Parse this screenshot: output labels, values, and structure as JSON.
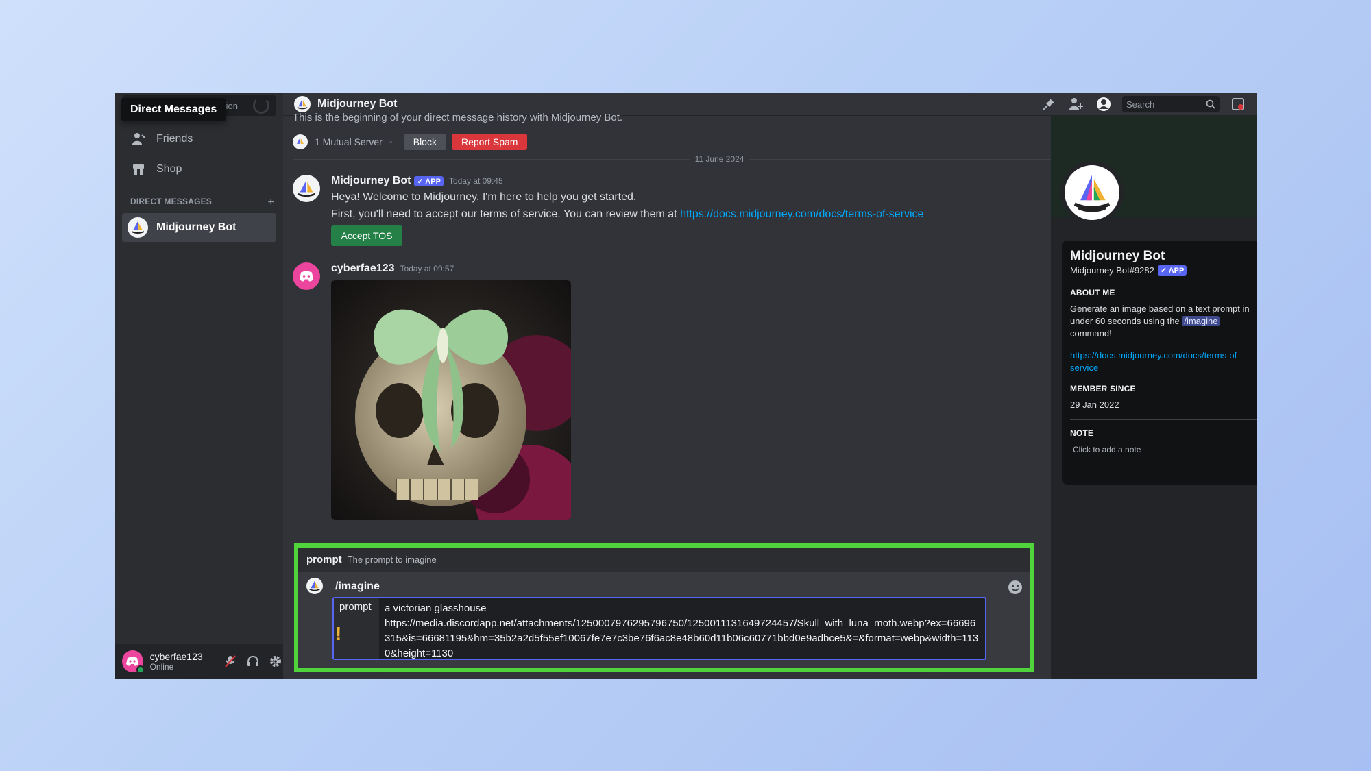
{
  "sidebar": {
    "tooltip": "Direct Messages",
    "search_fragment": "sation",
    "nav": [
      {
        "label": "Friends"
      },
      {
        "label": "Shop"
      }
    ],
    "dm_section_title": "DIRECT MESSAGES",
    "dm_add": "+",
    "dm_items": [
      {
        "label": "Midjourney Bot"
      }
    ]
  },
  "user": {
    "name": "cyberfae123",
    "status": "Online"
  },
  "topbar": {
    "title": "Midjourney Bot",
    "search_placeholder": "Search"
  },
  "chat": {
    "history_text": "This is the beginning of your direct message history with Midjourney Bot.",
    "mutual_server": "1 Mutual Server",
    "block_label": "Block",
    "report_label": "Report Spam",
    "date_divider": "11 June 2024",
    "messages": [
      {
        "author": "Midjourney Bot",
        "tag": "✓ APP",
        "time": "Today at 09:45",
        "line1": "Heya! Welcome to Midjourney. I'm here to help you get started.",
        "line2": "First, you'll need to accept our terms of service. You can review them at ",
        "link": "https://docs.midjourney.com/docs/terms-of-service",
        "button": "Accept TOS"
      },
      {
        "author": "cyberfae123",
        "time": "Today at 09:57"
      }
    ]
  },
  "composer": {
    "option_name": "prompt",
    "option_desc": "The prompt to imagine",
    "command": "/imagine",
    "param_label": "prompt",
    "param_line1": "a victorian glasshouse",
    "param_line2": "https://media.discordapp.net/attachments/1250007976295796750/1250011131649724457/Skull_with_luna_moth.webp?ex=66696315&is=66681195&hm=35b2a2d5f55ef10067fe7e7c3be76f6ac8e48b60d11b06c60771bbd0e9adbce5&=&format=webp&width=1130&height=1130",
    "warning": "!"
  },
  "profile": {
    "name": "Midjourney Bot",
    "handle": "Midjourney Bot#9282",
    "tag": "✓ APP",
    "about_title": "ABOUT ME",
    "about_pre": "Generate an image based on a text prompt in under 60 seconds using the ",
    "about_code": "/imagine",
    "about_post": " command!",
    "link": "https://docs.midjourney.com/docs/terms-of-service",
    "member_title": "MEMBER SINCE",
    "member_date": "29 Jan 2022",
    "note_title": "NOTE",
    "note_hint": "Click to add a note"
  },
  "colors": {
    "highlight_border": "#4fd53b",
    "danger": "#da373c",
    "success": "#248046",
    "blurple": "#5865f2",
    "link": "#00a8fc"
  }
}
